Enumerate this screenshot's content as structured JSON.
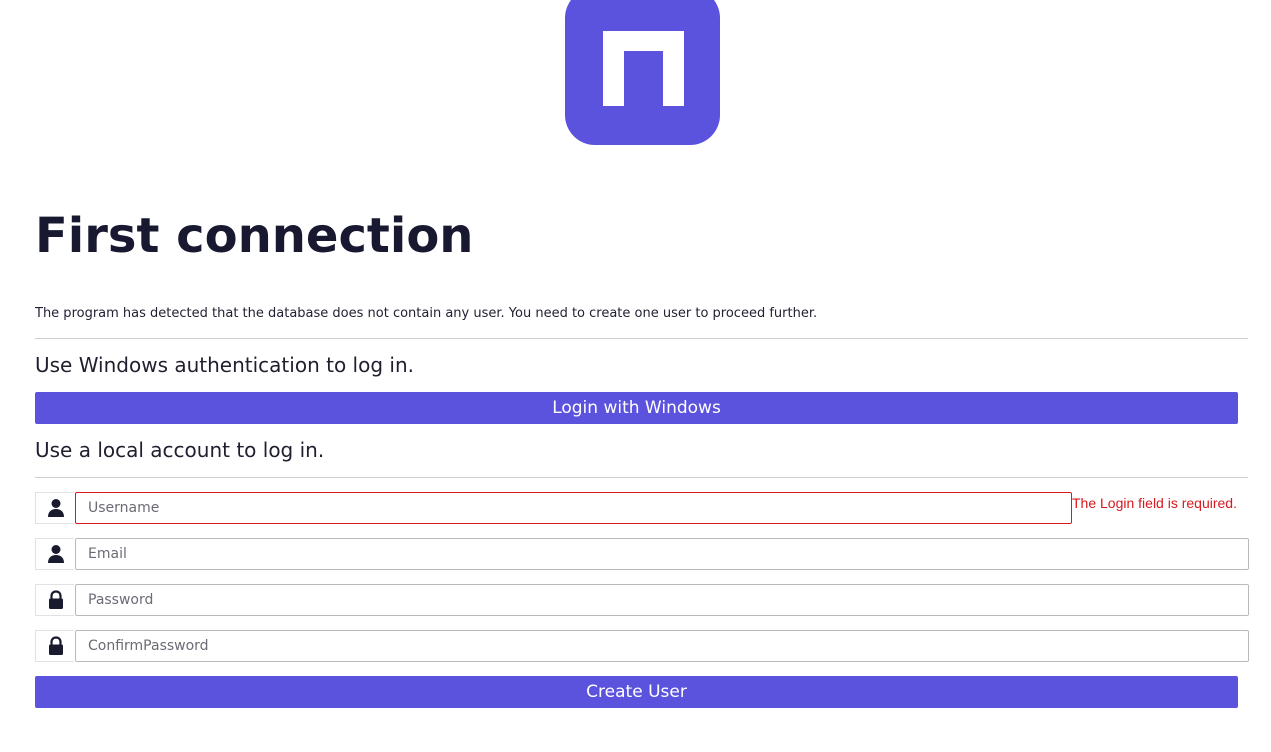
{
  "page": {
    "title": "First connection",
    "intro": "The program has detected that the database does not contain any user. You need to create one user to proceed further."
  },
  "windows_auth": {
    "heading": "Use Windows authentication to log in.",
    "button_label": "Login with Windows"
  },
  "local_account": {
    "heading": "Use a local account to log in.",
    "fields": [
      {
        "icon": "user-icon",
        "placeholder": "Username",
        "value": "",
        "error": "The Login field is required."
      },
      {
        "icon": "user-icon",
        "placeholder": "Email",
        "value": ""
      },
      {
        "icon": "lock-icon",
        "placeholder": "Password",
        "value": ""
      },
      {
        "icon": "lock-icon",
        "placeholder": "ConfirmPassword",
        "value": ""
      }
    ],
    "submit_label": "Create User"
  },
  "colors": {
    "brand": "#5b52dd",
    "error": "#d6191f",
    "text": "#181830"
  }
}
